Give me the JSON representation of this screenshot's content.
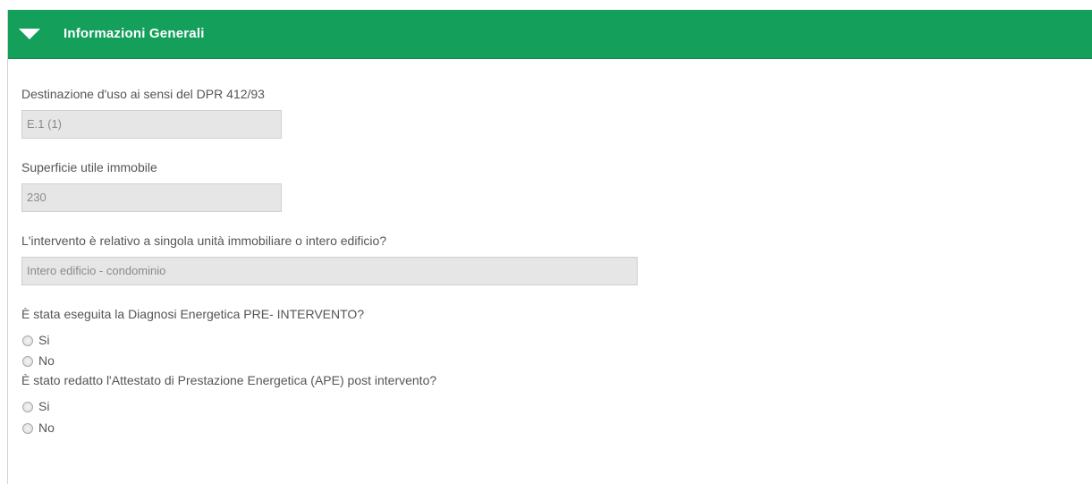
{
  "panel": {
    "title": "Informazioni Generali",
    "toggle_icon": "triangle-down-icon",
    "header_color": "#14a05a"
  },
  "fields": {
    "destinazione": {
      "label": "Destinazione d'uso ai sensi del DPR 412/93",
      "value": "E.1 (1)"
    },
    "superficie": {
      "label": "Superficie utile immobile",
      "value": "230"
    },
    "intervento": {
      "label": "L'intervento è relativo a singola unità immobiliare o intero edificio?",
      "value": "Intero edificio - condominio"
    }
  },
  "questions": {
    "diagnosi": {
      "label": "È stata eseguita la Diagnosi Energetica PRE- INTERVENTO?",
      "options": [
        "Si",
        "No"
      ],
      "selected": null
    },
    "ape": {
      "label": "È stato redatto l'Attestato di Prestazione Energetica (APE) post intervento?",
      "options": [
        "Si",
        "No"
      ],
      "selected": null
    }
  }
}
